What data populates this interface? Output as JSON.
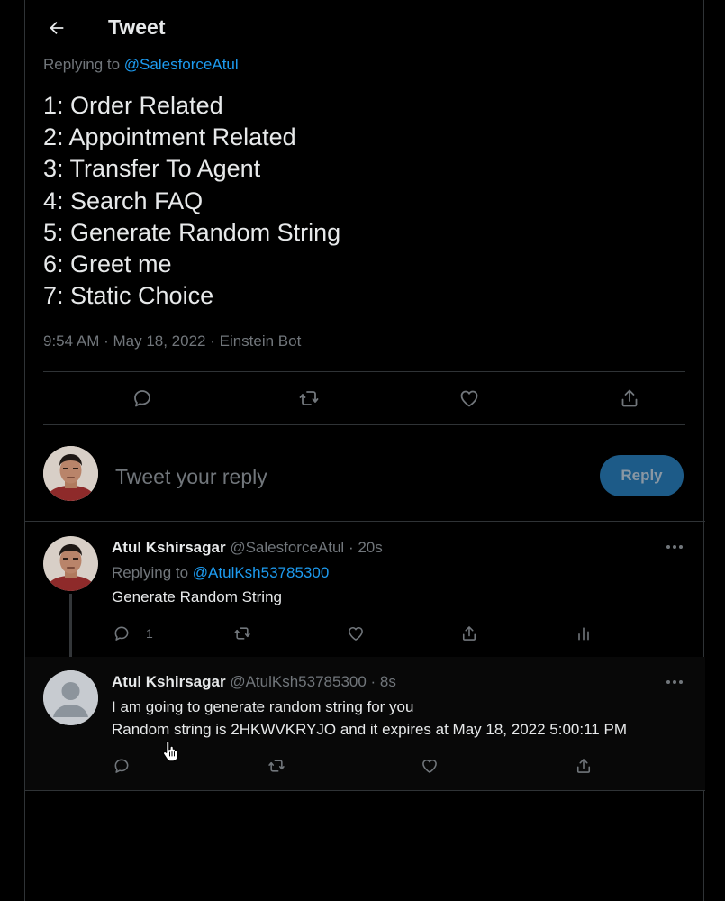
{
  "header": {
    "title": "Tweet",
    "back_icon": "arrow-left-icon"
  },
  "main_tweet": {
    "replying_prefix": "Replying to",
    "replying_to": "@SalesforceAtul",
    "lines": [
      "1: Order Related",
      "2: Appointment Related",
      "3: Transfer To Agent",
      "4: Search FAQ",
      "5: Generate Random String",
      "6: Greet me",
      "7: Static Choice"
    ],
    "meta": "9:54 AM · May 18, 2022 · Einstein Bot",
    "actions": [
      "reply-icon",
      "retweet-icon",
      "like-icon",
      "share-icon"
    ]
  },
  "composer": {
    "placeholder": "Tweet your reply",
    "button_label": "Reply"
  },
  "thread": [
    {
      "name": "Atul Kshirsagar",
      "handle": "@SalesforceAtul",
      "time": "· 20s",
      "replying_prefix": "Replying to",
      "replying_to": "@AtulKsh53785300",
      "text": [
        "Generate Random String"
      ],
      "reply_count": "1"
    },
    {
      "name": "Atul Kshirsagar",
      "handle": "@AtulKsh53785300",
      "time": "· 8s",
      "text": [
        "I am going to generate random string for you",
        "Random string is 2HKWVKRYJO and it expires at May 18, 2022 5:00:11 PM"
      ]
    }
  ],
  "colors": {
    "background": "#000000",
    "text": "#e7e9ea",
    "muted": "#71767b",
    "accent": "#1d9bf0",
    "divider": "#2f3336",
    "reply_button": "#1d5b88"
  }
}
